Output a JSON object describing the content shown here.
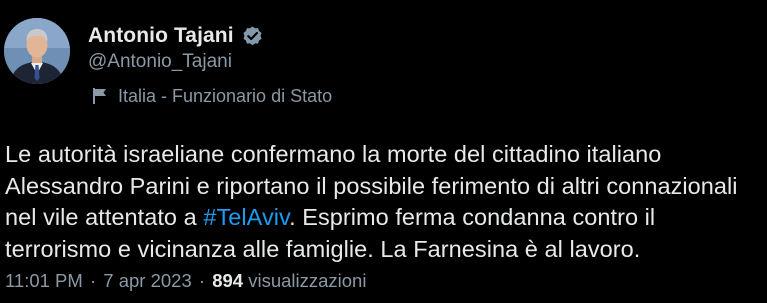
{
  "author": {
    "display_name": "Antonio Tajani",
    "handle": "@Antonio_Tajani",
    "verified_color": "#829aab",
    "label": "Italia - Funzionario di Stato",
    "label_icon": "flag-icon",
    "avatar_icon": "profile-photo"
  },
  "tweet": {
    "line1": "Le autorità israeliane confermano la morte del cittadino italiano",
    "line2": "Alessandro Parini e riportano il possibile ferimento di altri connazionali",
    "line3_before": "nel vile attentato a ",
    "hashtag": "#TelAviv",
    "line3_after": ". Esprimo ferma condanna contro il",
    "line4": "terrorismo e vicinanza alle famiglie. La Farnesina è al lavoro.",
    "hashtag_color": "#1d9bf0"
  },
  "meta": {
    "time": "11:01 PM",
    "separator1": "·",
    "date": "7 apr 2023",
    "separator2": "·",
    "views_count": "894",
    "views_label": "visualizzazioni"
  },
  "colors": {
    "background": "#000000",
    "primary_text": "#e7e9ea",
    "secondary_text": "#8b98a5"
  }
}
